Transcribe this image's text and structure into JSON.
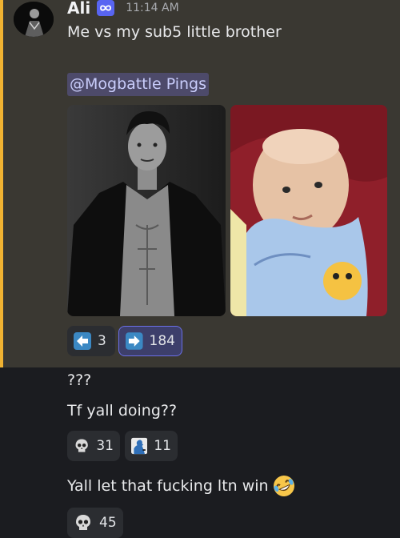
{
  "message": {
    "author": "Ali",
    "timestamp": "11:14 AM",
    "text": "Me vs my sub5 little brother",
    "mention": "@Mogbattle Pings",
    "images": [
      "man-in-leather-jacket-photo",
      "baby-photo"
    ],
    "reactions": [
      {
        "icon": "left-arrow-emoji",
        "count": "3"
      },
      {
        "icon": "right-arrow-emoji",
        "count": "184"
      }
    ]
  },
  "replies": [
    {
      "text": "???"
    },
    {
      "text": "Tf yall doing??",
      "reactions": [
        {
          "icon": "skull-emoji",
          "count": "31"
        },
        {
          "icon": "silhouette-emoji",
          "count": "11"
        }
      ]
    },
    {
      "text": "Yall let that fucking ltn win",
      "trailing_emoji": "rolling-laughing-emoji",
      "reactions": [
        {
          "icon": "skull-emoji",
          "count": "45"
        }
      ]
    }
  ],
  "colors": {
    "highlight_bg": "#3a3832",
    "highlight_bar": "#f0b232",
    "mention_bg": "#4d4a6a",
    "mention_text": "#c9cdfb",
    "reaction_selected_bg": "#3d3f6b",
    "reaction_selected_border": "#6a6fe8",
    "arrow_blue": "#3b88c3"
  }
}
